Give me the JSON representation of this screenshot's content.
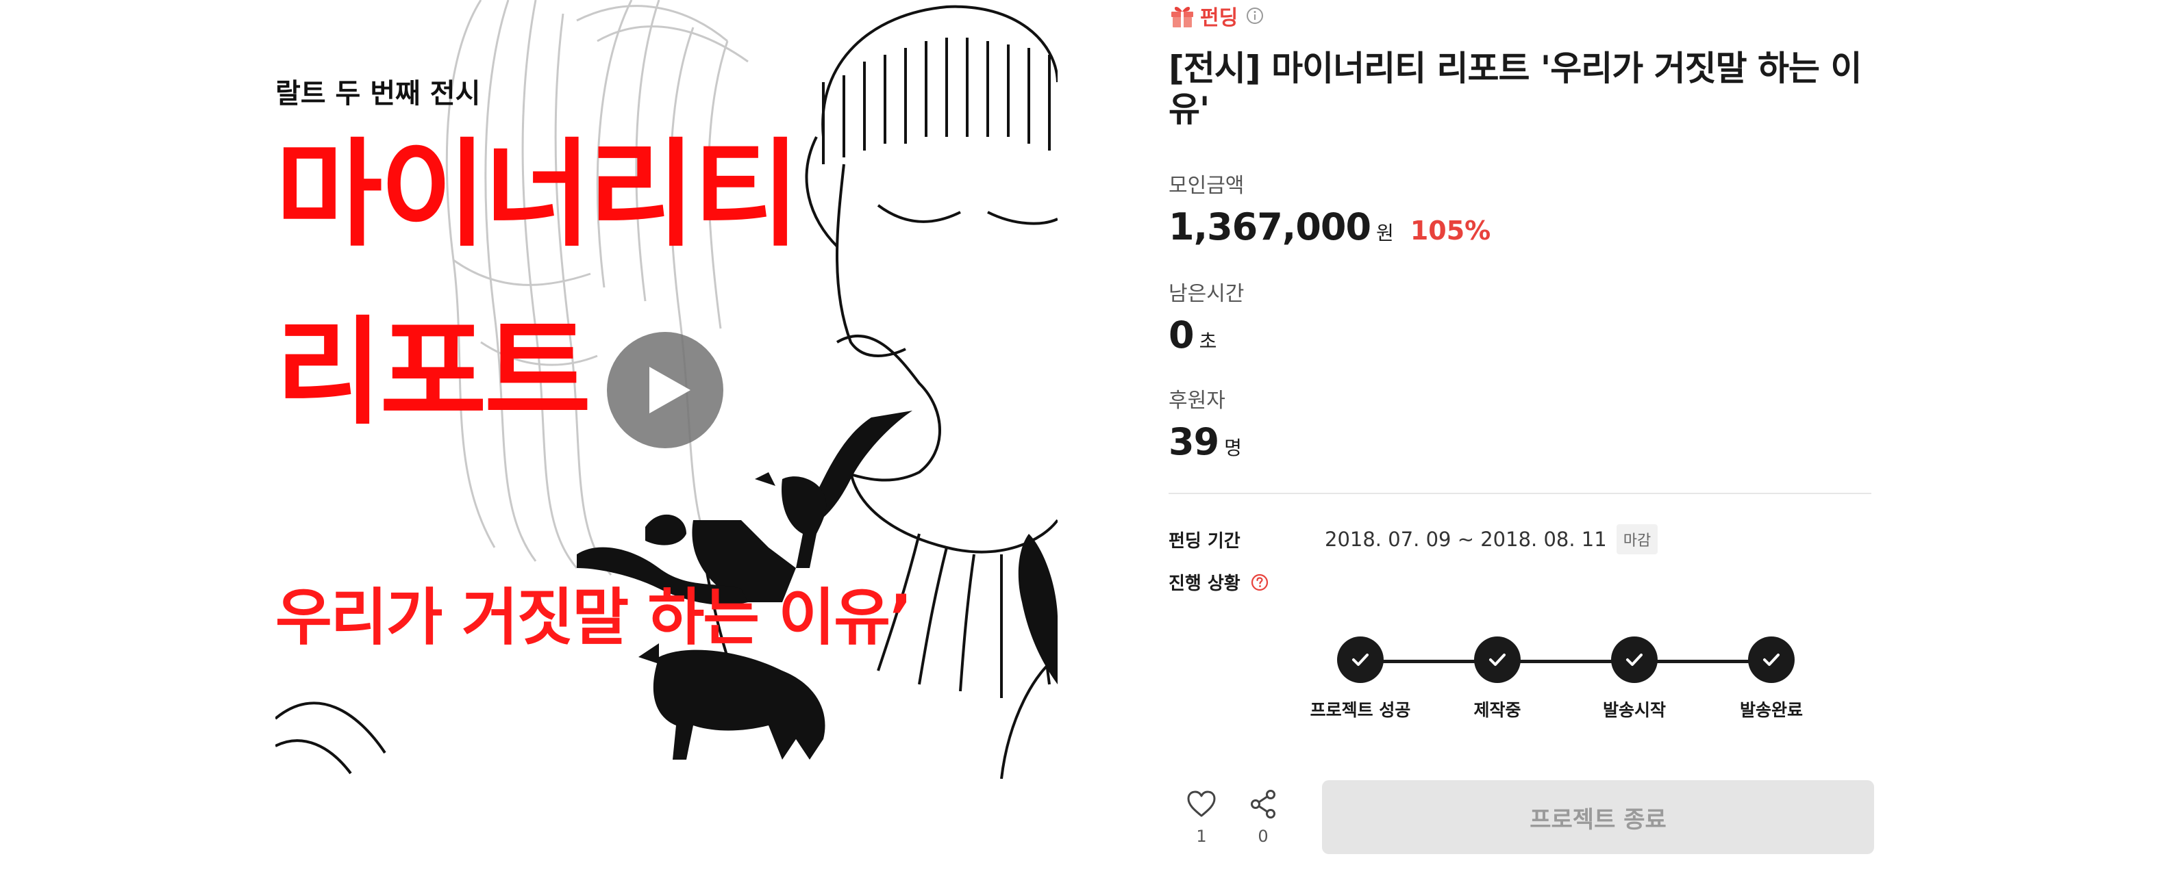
{
  "media": {
    "subtitle": "랄트 두 번째 전시",
    "title_line1": "마이너리티",
    "title_line2": "리포트",
    "tagline": "우리가 거짓말 하는 이유’",
    "play_icon": "play-icon"
  },
  "project": {
    "category": "펀딩",
    "title": "[전시] 마이너리티 리포트 '우리가 거짓말 하는 이유'",
    "stats": {
      "raised_label": "모인금액",
      "raised_value": "1,367,000",
      "raised_unit": "원",
      "raised_percent": "105%",
      "time_label": "남은시간",
      "time_value": "0",
      "time_unit": "초",
      "backers_label": "후원자",
      "backers_value": "39",
      "backers_unit": "명"
    },
    "period": {
      "label": "펀딩 기간",
      "value": "2018. 07. 09 ~ 2018. 08. 11",
      "badge": "마감"
    },
    "progress": {
      "label": "진행 상황",
      "steps": [
        {
          "label": "프로젝트 성공"
        },
        {
          "label": "제작중"
        },
        {
          "label": "발송시작"
        },
        {
          "label": "발송완료"
        }
      ]
    },
    "actions": {
      "like_count": "1",
      "share_count": "0",
      "end_button": "프로젝트 종료"
    },
    "colors": {
      "accent": "#e8423c",
      "poster_red": "#ff0a0a",
      "disabled_button": "#e5e5e5"
    }
  }
}
